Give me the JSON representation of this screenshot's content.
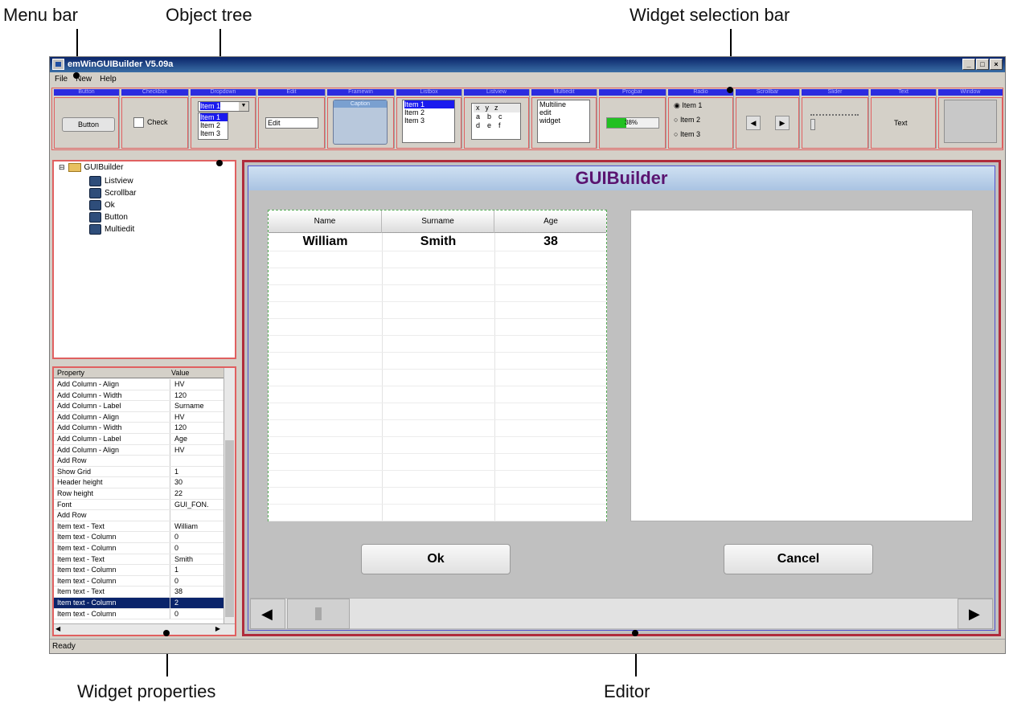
{
  "callouts": {
    "menu_bar": "Menu bar",
    "object_tree": "Object tree",
    "widget_selection_bar": "Widget selection bar",
    "widget_properties": "Widget properties",
    "editor": "Editor"
  },
  "window": {
    "title": "emWinGUIBuilder V5.09a",
    "controls": [
      "_",
      "□",
      "×"
    ]
  },
  "menu": [
    "File",
    "New",
    "Help"
  ],
  "widgets": [
    {
      "header": "Button",
      "sample": "Button"
    },
    {
      "header": "Checkbox",
      "sample": "Check"
    },
    {
      "header": "Dropdown",
      "selected": "Item 1",
      "items": [
        "Item 1",
        "Item 2",
        "Item 3"
      ]
    },
    {
      "header": "Edit",
      "sample": "Edit"
    },
    {
      "header": "Framewin",
      "sample": "Caption"
    },
    {
      "header": "Listbox",
      "items": [
        "Item 1",
        "Item 2",
        "Item 3"
      ]
    },
    {
      "header": "Listview",
      "cols": [
        "x",
        "y",
        "z"
      ],
      "rows": [
        [
          "a",
          "b",
          "c"
        ],
        [
          "d",
          "e",
          "f"
        ]
      ]
    },
    {
      "header": "Multiedit",
      "lines": [
        "Multiline",
        "edit",
        "widget"
      ]
    },
    {
      "header": "Progbar",
      "sample": "38%",
      "progress": 0.38
    },
    {
      "header": "Radio",
      "items": [
        "Item 1",
        "Item 2",
        "Item 3"
      ]
    },
    {
      "header": "Scrollbar"
    },
    {
      "header": "Slider"
    },
    {
      "header": "Text",
      "sample": "Text"
    },
    {
      "header": "Window"
    }
  ],
  "tree": {
    "root": "GUIBuilder",
    "children": [
      "Listview",
      "Scrollbar",
      "Ok",
      "Button",
      "Multiedit"
    ]
  },
  "properties": {
    "headers": [
      "Property",
      "Value"
    ],
    "rows": [
      [
        "Add Column - Align",
        "HV"
      ],
      [
        "Add Column - Width",
        "120"
      ],
      [
        "Add Column - Label",
        "Surname"
      ],
      [
        "Add Column - Align",
        "HV"
      ],
      [
        "Add Column - Width",
        "120"
      ],
      [
        "Add Column - Label",
        "Age"
      ],
      [
        "Add Column - Align",
        "HV"
      ],
      [
        "Add Row",
        ""
      ],
      [
        "Show Grid",
        "1"
      ],
      [
        "Header height",
        "30"
      ],
      [
        "Row height",
        "22"
      ],
      [
        "Font",
        "GUI_FON."
      ],
      [
        "Add Row",
        ""
      ],
      [
        "Item text - Text",
        "William"
      ],
      [
        "Item text - Column",
        "0"
      ],
      [
        "Item text - Column",
        "0"
      ],
      [
        "Item text - Text",
        "Smith"
      ],
      [
        "Item text - Column",
        "1"
      ],
      [
        "Item text - Column",
        "0"
      ],
      [
        "Item text - Text",
        "38"
      ],
      [
        "Item text - Column",
        "2"
      ],
      [
        "Item text - Column",
        "0"
      ]
    ],
    "selected_index": 20
  },
  "status": "Ready",
  "editor": {
    "title": "GUIBuilder",
    "listview": {
      "headers": [
        "Name",
        "Surname",
        "Age"
      ],
      "row": [
        "William",
        "Smith",
        "38"
      ]
    },
    "ok_label": "Ok",
    "cancel_label": "Cancel"
  }
}
